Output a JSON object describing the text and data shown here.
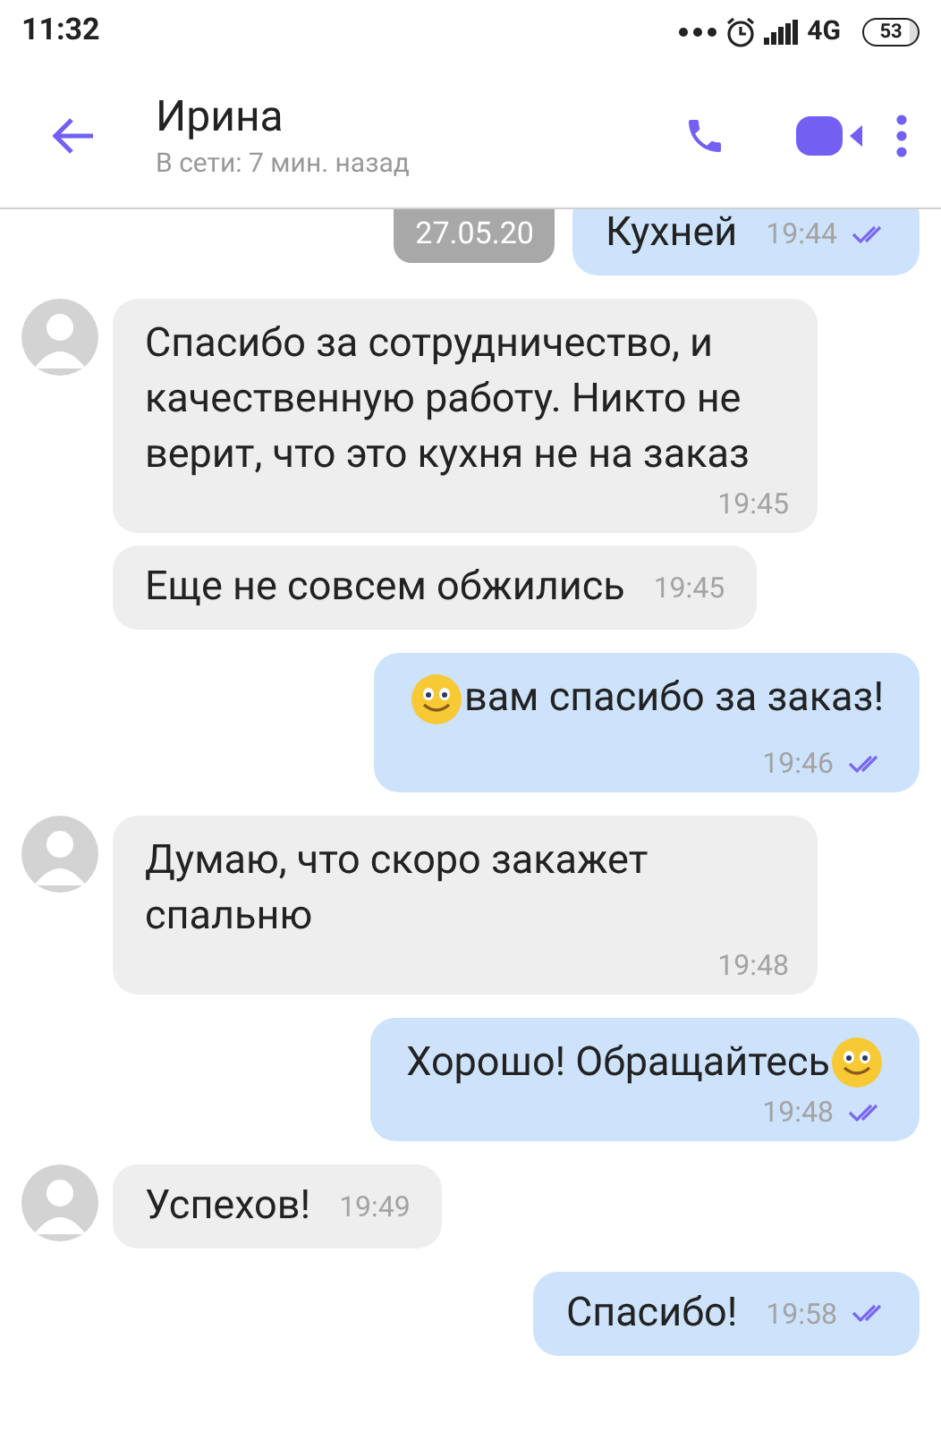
{
  "status_bar": {
    "time": "11:32",
    "network": "4G",
    "battery": "53"
  },
  "header": {
    "name": "Ирина",
    "status": "В сети: 7 мин. назад"
  },
  "date_badge": "27.05.20",
  "messages": [
    {
      "kind": "outgoing",
      "parts": [
        {
          "kind": "text",
          "text": "Кухней"
        }
      ],
      "time": "19:44",
      "time_below": false,
      "read": true
    },
    {
      "kind": "incoming",
      "avatar": true,
      "parts": [
        {
          "kind": "text",
          "text": "Спасибо за сотрудничество, и качественную работу. Никто не верит, что это кухня не на заказ"
        }
      ],
      "time": "19:45",
      "time_below": true
    },
    {
      "kind": "incoming",
      "avatar": false,
      "parts": [
        {
          "kind": "text",
          "text": "Еще не совсем обжились"
        }
      ],
      "time": "19:45",
      "time_below": false
    },
    {
      "kind": "outgoing",
      "parts": [
        {
          "kind": "emoji"
        },
        {
          "kind": "text",
          "text": "вам спасибо за заказ!"
        }
      ],
      "time": "19:46",
      "time_below": true,
      "read": true
    },
    {
      "kind": "incoming",
      "avatar": true,
      "parts": [
        {
          "kind": "text",
          "text": "Думаю, что скоро закажет спальню"
        }
      ],
      "time": "19:48",
      "time_below": true
    },
    {
      "kind": "outgoing",
      "parts": [
        {
          "kind": "text",
          "text": "Хорошо! Обращайтесь"
        },
        {
          "kind": "emoji"
        }
      ],
      "time": "19:48",
      "time_below": true,
      "read": true
    },
    {
      "kind": "incoming",
      "avatar": true,
      "parts": [
        {
          "kind": "text",
          "text": "Успехов!"
        }
      ],
      "time": "19:49",
      "time_below": false
    },
    {
      "kind": "outgoing",
      "parts": [
        {
          "kind": "text",
          "text": "Спасибо!"
        }
      ],
      "time": "19:58",
      "time_below": false,
      "read": true
    }
  ]
}
